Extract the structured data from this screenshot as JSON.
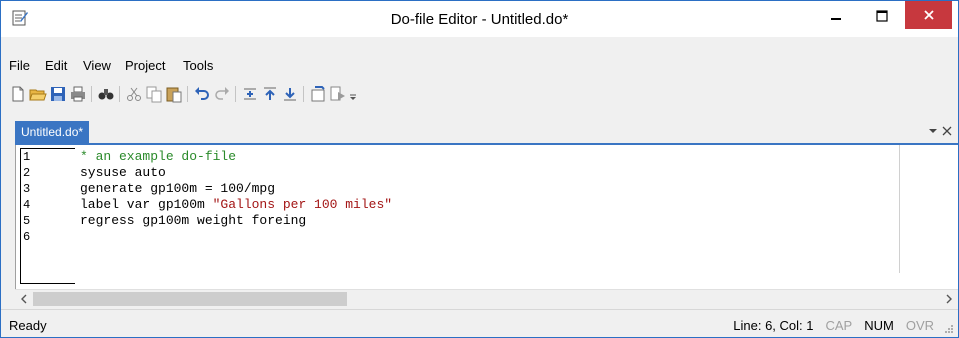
{
  "window": {
    "title": "Do-file Editor - Untitled.do*"
  },
  "menu": [
    "File",
    "Edit",
    "View",
    "Project",
    "Tools"
  ],
  "toolbar": {
    "buttons": [
      "new-file-icon",
      "open-folder-icon",
      "save-icon",
      "print-icon",
      "find-icon",
      "cut-icon",
      "copy-icon",
      "paste-icon",
      "undo-icon",
      "redo-icon",
      "indent-icon",
      "move-up-icon",
      "move-down-icon",
      "bookmark-icon",
      "execute-icon",
      "toolbar-options-icon"
    ]
  },
  "tab": {
    "label": "Untitled.do*"
  },
  "editor": {
    "line_numbers": [
      "1",
      "2",
      "3",
      "4",
      "5",
      "6"
    ],
    "lines": [
      {
        "segments": [
          {
            "text": "* an example do-file",
            "kind": "comment"
          }
        ]
      },
      {
        "segments": [
          {
            "text": "sysuse auto",
            "kind": "plain"
          }
        ]
      },
      {
        "segments": [
          {
            "text": "generate gp100m = 100/mpg",
            "kind": "plain"
          }
        ]
      },
      {
        "segments": [
          {
            "text": "label var gp100m ",
            "kind": "plain"
          },
          {
            "text": "\"Gallons per 100 miles\"",
            "kind": "string"
          }
        ]
      },
      {
        "segments": [
          {
            "text": "regress gp100m weight foreing",
            "kind": "plain"
          }
        ]
      },
      {
        "segments": [
          {
            "text": "",
            "kind": "plain"
          }
        ]
      }
    ]
  },
  "status": {
    "ready": "Ready",
    "position": "Line: 6, Col: 1",
    "cap": "CAP",
    "num": "NUM",
    "ovr": "OVR"
  },
  "colors": {
    "tab_accent": "#3a75c3",
    "close_button": "#c7383e",
    "comment": "#2a8a2a",
    "string": "#a31515"
  }
}
